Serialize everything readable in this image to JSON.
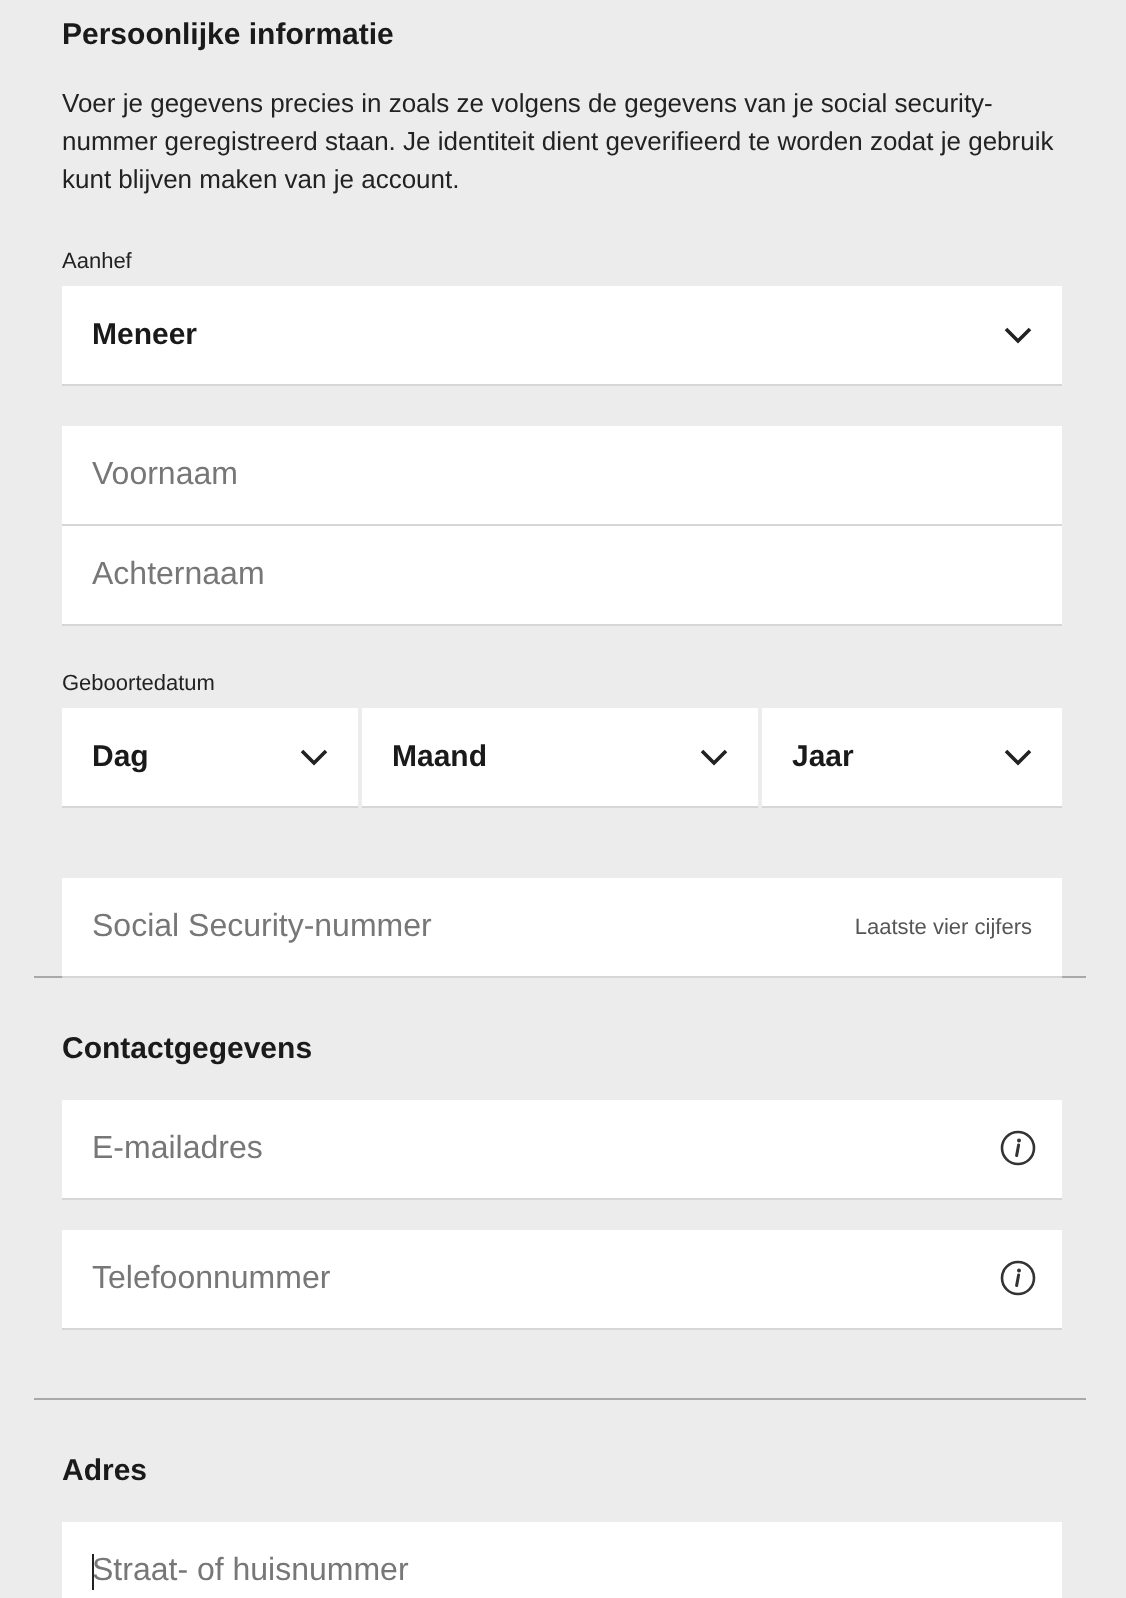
{
  "personal": {
    "title": "Persoonlijke informatie",
    "intro": "Voer je gegevens precies in zoals ze volgens de gegevens van je social security-nummer geregistreerd staan. Je identiteit dient geverifieerd te worden zodat je gebruik kunt blijven maken van je account.",
    "salutation": {
      "label": "Aanhef",
      "value": "Meneer"
    },
    "name_fields": [
      {
        "placeholder": "Voornaam"
      },
      {
        "placeholder": "Achternaam"
      }
    ],
    "birthdate": {
      "label": "Geboortedatum",
      "selects": [
        {
          "value": "Dag"
        },
        {
          "value": "Maand"
        },
        {
          "value": "Jaar"
        }
      ]
    },
    "ssn": {
      "placeholder": "Social Security-nummer",
      "hint": "Laatste vier cijfers"
    }
  },
  "contact": {
    "title": "Contactgegevens",
    "fields": [
      {
        "placeholder": "E-mailadres",
        "kind": "info",
        "focused": false
      },
      {
        "placeholder": "Telefoonnummer",
        "kind": "info",
        "focused": false
      }
    ]
  },
  "address": {
    "title": "Adres",
    "fields": [
      {
        "placeholder": "Straat- of huisnummer",
        "focused": true
      }
    ]
  }
}
